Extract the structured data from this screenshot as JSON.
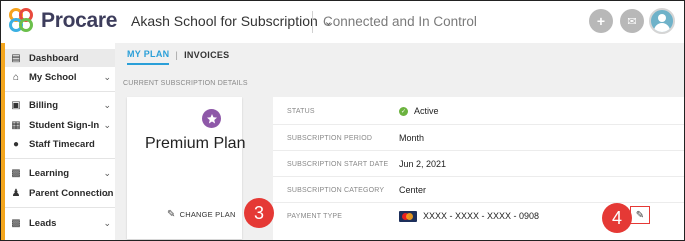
{
  "app": {
    "brand": "Procare",
    "school_name": "Akash School for Subscription",
    "tagline": "Connected and In Control"
  },
  "topbar": {
    "icons": [
      "add-icon",
      "mail-icon",
      "user-avatar"
    ]
  },
  "sidebar": {
    "items": [
      {
        "label": "Dashboard",
        "icon": "dashboard-icon",
        "active": true,
        "has_chevron": false
      },
      {
        "label": "My School",
        "icon": "school-icon",
        "active": false,
        "has_chevron": true
      },
      {
        "label": "Billing",
        "icon": "billing-icon",
        "active": false,
        "has_chevron": true
      },
      {
        "label": "Student Sign-In",
        "icon": "sign-in-icon",
        "active": false,
        "has_chevron": true
      },
      {
        "label": "Staff Timecard",
        "icon": "timecard-icon",
        "active": false,
        "has_chevron": false
      },
      {
        "label": "Learning",
        "icon": "learning-icon",
        "active": false,
        "has_chevron": true
      },
      {
        "label": "Parent Connection",
        "icon": "parent-icon",
        "active": false,
        "has_chevron": true
      },
      {
        "label": "Leads",
        "icon": "leads-icon",
        "active": false,
        "has_chevron": true
      }
    ]
  },
  "main": {
    "tabs": [
      {
        "label": "MY PLAN",
        "active": true
      },
      {
        "label": "INVOICES",
        "active": false
      }
    ],
    "section_title": "CURRENT SUBSCRIPTION DETAILS",
    "plan": {
      "name": "Premium Plan",
      "change_label": "CHANGE PLAN"
    },
    "details": [
      {
        "label": "STATUS",
        "value": "Active"
      },
      {
        "label": "SUBSCRIPTION PERIOD",
        "value": "Month"
      },
      {
        "label": "SUBSCRIPTION START DATE",
        "value": "Jun 2, 2021"
      },
      {
        "label": "SUBSCRIPTION CATEGORY",
        "value": "Center"
      },
      {
        "label": "PAYMENT TYPE",
        "value": "XXXX - XXXX - XXXX - 0908"
      }
    ]
  },
  "markers": {
    "step_3": "3",
    "step_4": "4"
  },
  "colors": {
    "accent": "#2a9fd8",
    "brand_orange": "#f4a61d",
    "plan_badge": "#8e58a8",
    "status_active": "#6cb33f",
    "marker": "#e53935"
  }
}
